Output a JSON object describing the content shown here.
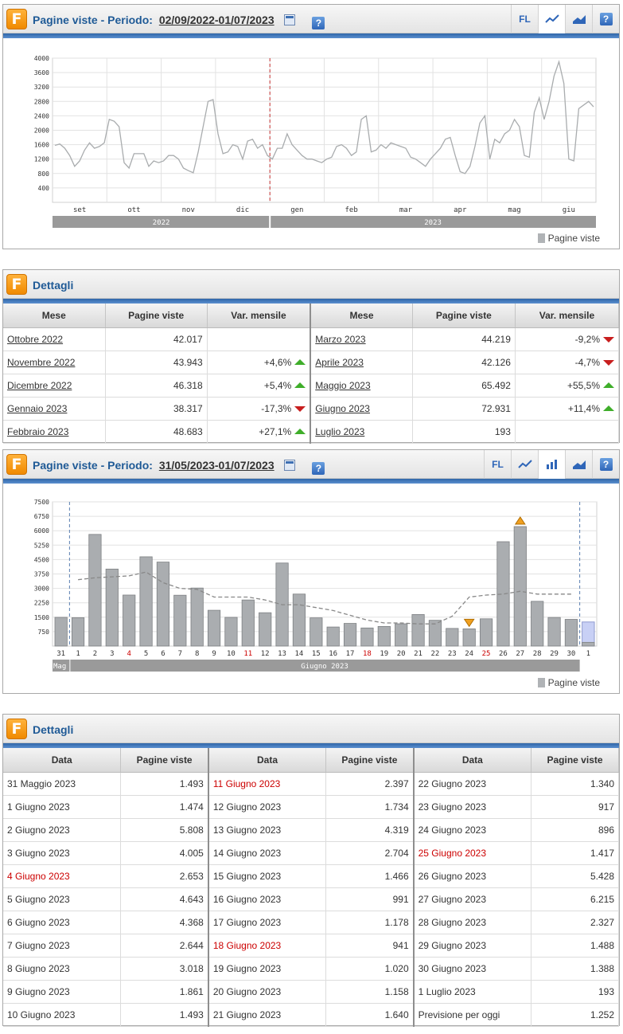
{
  "panel1": {
    "title": "Pagine viste - Periodo:",
    "period": "02/09/2022-01/07/2023",
    "tools": {
      "fl": "FL",
      "help": "?"
    },
    "legend": "Pagine viste"
  },
  "details1": {
    "title": "Dettagli",
    "headers": [
      "Mese",
      "Pagine viste",
      "Var. mensile",
      "Mese",
      "Pagine viste",
      "Var. mensile"
    ],
    "rows": [
      {
        "m1": "Ottobre 2022",
        "v1": "42.017",
        "d1": "",
        "t1": "",
        "m2": "Marzo 2023",
        "v2": "44.219",
        "d2": "-9,2%",
        "t2": "down"
      },
      {
        "m1": "Novembre 2022",
        "v1": "43.943",
        "d1": "+4,6%",
        "t1": "up",
        "m2": "Aprile 2023",
        "v2": "42.126",
        "d2": "-4,7%",
        "t2": "down"
      },
      {
        "m1": "Dicembre 2022",
        "v1": "46.318",
        "d1": "+5,4%",
        "t1": "up",
        "m2": "Maggio 2023",
        "v2": "65.492",
        "d2": "+55,5%",
        "t2": "up"
      },
      {
        "m1": "Gennaio 2023",
        "v1": "38.317",
        "d1": "-17,3%",
        "t1": "down",
        "m2": "Giugno 2023",
        "v2": "72.931",
        "d2": "+11,4%",
        "t2": "up"
      },
      {
        "m1": "Febbraio 2023",
        "v1": "48.683",
        "d1": "+27,1%",
        "t1": "up",
        "m2": "Luglio 2023",
        "v2": "193",
        "d2": "",
        "t2": ""
      }
    ]
  },
  "panel2": {
    "title": "Pagine viste - Periodo:",
    "period": "31/05/2023-01/07/2023",
    "tools": {
      "fl": "FL",
      "help": "?"
    },
    "legend": "Pagine viste"
  },
  "details2": {
    "title": "Dettagli",
    "headers": [
      "Data",
      "Pagine viste",
      "Data",
      "Pagine viste",
      "Data",
      "Pagine viste"
    ],
    "rows": [
      [
        [
          "31 Maggio 2023",
          "1.493",
          false
        ],
        [
          "11 Giugno 2023",
          "2.397",
          true
        ],
        [
          "22 Giugno 2023",
          "1.340",
          false
        ]
      ],
      [
        [
          "1 Giugno 2023",
          "1.474",
          false
        ],
        [
          "12 Giugno 2023",
          "1.734",
          false
        ],
        [
          "23 Giugno 2023",
          "917",
          false
        ]
      ],
      [
        [
          "2 Giugno 2023",
          "5.808",
          false
        ],
        [
          "13 Giugno 2023",
          "4.319",
          false
        ],
        [
          "24 Giugno 2023",
          "896",
          false
        ]
      ],
      [
        [
          "3 Giugno 2023",
          "4.005",
          false
        ],
        [
          "14 Giugno 2023",
          "2.704",
          false
        ],
        [
          "25 Giugno 2023",
          "1.417",
          true
        ]
      ],
      [
        [
          "4 Giugno 2023",
          "2.653",
          true
        ],
        [
          "15 Giugno 2023",
          "1.466",
          false
        ],
        [
          "26 Giugno 2023",
          "5.428",
          false
        ]
      ],
      [
        [
          "5 Giugno 2023",
          "4.643",
          false
        ],
        [
          "16 Giugno 2023",
          "991",
          false
        ],
        [
          "27 Giugno 2023",
          "6.215",
          false
        ]
      ],
      [
        [
          "6 Giugno 2023",
          "4.368",
          false
        ],
        [
          "17 Giugno 2023",
          "1.178",
          false
        ],
        [
          "28 Giugno 2023",
          "2.327",
          false
        ]
      ],
      [
        [
          "7 Giugno 2023",
          "2.644",
          false
        ],
        [
          "18 Giugno 2023",
          "941",
          true
        ],
        [
          "29 Giugno 2023",
          "1.488",
          false
        ]
      ],
      [
        [
          "8 Giugno 2023",
          "3.018",
          false
        ],
        [
          "19 Giugno 2023",
          "1.020",
          false
        ],
        [
          "30 Giugno 2023",
          "1.388",
          false
        ]
      ],
      [
        [
          "9 Giugno 2023",
          "1.861",
          false
        ],
        [
          "20 Giugno 2023",
          "1.158",
          false
        ],
        [
          "1 Luglio 2023",
          "193",
          false
        ]
      ],
      [
        [
          "10 Giugno 2023",
          "1.493",
          false
        ],
        [
          "21 Giugno 2023",
          "1.640",
          false
        ],
        [
          "Previsione per oggi",
          "1.252",
          false
        ]
      ]
    ]
  },
  "chart_data": [
    {
      "type": "line",
      "ylim": [
        0,
        4000
      ],
      "yticks": [
        400,
        800,
        1200,
        1600,
        2000,
        2400,
        2800,
        3200,
        3600,
        4000
      ],
      "month_labels": [
        "set",
        "ott",
        "nov",
        "dic",
        "gen",
        "feb",
        "mar",
        "apr",
        "mag",
        "giu"
      ],
      "year_labels": [
        "2022",
        "2023"
      ],
      "grid": true,
      "legend": "bottom-right",
      "series": [
        {
          "name": "Pagine viste",
          "color": "#a9acae",
          "values": [
            1580,
            1620,
            1500,
            1300,
            1000,
            1150,
            1450,
            1650,
            1500,
            1550,
            1650,
            2300,
            2250,
            2100,
            1100,
            950,
            1350,
            1350,
            1350,
            1000,
            1150,
            1100,
            1150,
            1300,
            1300,
            1200,
            950,
            880,
            820,
            1400,
            2100,
            2800,
            2850,
            1900,
            1350,
            1400,
            1600,
            1550,
            1200,
            1700,
            1750,
            1500,
            1600,
            1300,
            1200,
            1500,
            1500,
            1900,
            1600,
            1450,
            1300,
            1200,
            1200,
            1150,
            1100,
            1200,
            1250,
            1550,
            1600,
            1500,
            1300,
            1400,
            2300,
            2400,
            1400,
            1450,
            1600,
            1500,
            1650,
            1600,
            1550,
            1500,
            1250,
            1200,
            1100,
            1000,
            1200,
            1350,
            1500,
            1750,
            1800,
            1300,
            850,
            800,
            1000,
            1550,
            2200,
            2400,
            1200,
            1750,
            1650,
            1900,
            2000,
            2300,
            2100,
            1300,
            1250,
            2500,
            2900,
            2300,
            2800,
            3500,
            3900,
            3300,
            1200,
            1150,
            2600,
            2700,
            2800,
            2650
          ]
        }
      ]
    },
    {
      "type": "bar",
      "ylim": [
        0,
        7500
      ],
      "yticks": [
        750,
        1500,
        2250,
        3000,
        3750,
        4500,
        5250,
        6000,
        6750,
        7500
      ],
      "categories": [
        "31",
        "1",
        "2",
        "3",
        "4",
        "5",
        "6",
        "7",
        "8",
        "9",
        "10",
        "11",
        "12",
        "13",
        "14",
        "15",
        "16",
        "17",
        "18",
        "19",
        "20",
        "21",
        "22",
        "23",
        "24",
        "25",
        "26",
        "27",
        "28",
        "29",
        "30",
        "1"
      ],
      "holidays": [
        "4",
        "11",
        "18",
        "25"
      ],
      "month_labels": [
        "Mag",
        "Giugno 2023"
      ],
      "grid": true,
      "legend": "bottom-right",
      "series": [
        {
          "name": "Pagine viste",
          "color": "#aaadb0",
          "values": [
            1493,
            1474,
            5808,
            4005,
            2653,
            4643,
            4368,
            2644,
            3018,
            1861,
            1493,
            2397,
            1734,
            4319,
            2704,
            1466,
            991,
            1178,
            941,
            1020,
            1158,
            1640,
            1340,
            917,
            896,
            1417,
            5428,
            6215,
            2327,
            1488,
            1388,
            193
          ]
        },
        {
          "name": "",
          "color": "#c8d0f5",
          "values": [
            0,
            0,
            0,
            0,
            0,
            0,
            0,
            0,
            0,
            0,
            0,
            0,
            0,
            0,
            0,
            0,
            0,
            0,
            0,
            0,
            0,
            0,
            0,
            0,
            0,
            0,
            0,
            0,
            0,
            0,
            0,
            1252
          ]
        },
        {
          "name": "",
          "color": "#888888",
          "values": [
            null,
            3450,
            3550,
            3600,
            3650,
            3850,
            3300,
            3000,
            2950,
            2550,
            2550,
            2550,
            2400,
            2150,
            2150,
            2000,
            1850,
            1600,
            1350,
            1200,
            1200,
            1150,
            1150,
            1550,
            2550,
            2650,
            2700,
            2850,
            2700,
            2700,
            2700,
            null
          ]
        }
      ]
    }
  ]
}
